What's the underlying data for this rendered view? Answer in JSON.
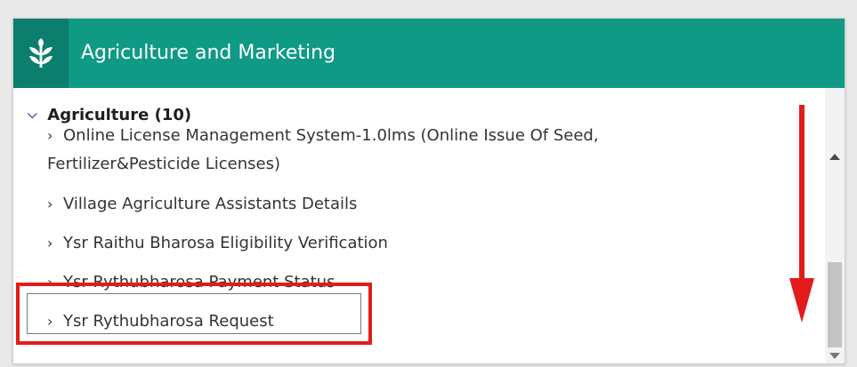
{
  "header": {
    "title": "Agriculture and Marketing",
    "icon": "leaf-sprout-icon",
    "color": "#0f9a86",
    "icon_bg": "#0b7e6d"
  },
  "category": {
    "label": "Agriculture (10)",
    "expanded": true
  },
  "items": [
    {
      "label": "Online License Management System-1.0lms (Online Issue Of Seed,",
      "label_cont": "Fertilizer&Pesticide Licenses)"
    },
    {
      "label": "Village Agriculture Assistants Details"
    },
    {
      "label": "Ysr Raithu Bharosa Eligibility Verification"
    },
    {
      "label": "Ysr Rythubharosa Payment Status"
    },
    {
      "label": "Ysr Rythubharosa Request",
      "highlighted": true
    }
  ],
  "annotation": {
    "highlight_color": "#e31b1b",
    "arrow": "down-arrow-icon"
  }
}
